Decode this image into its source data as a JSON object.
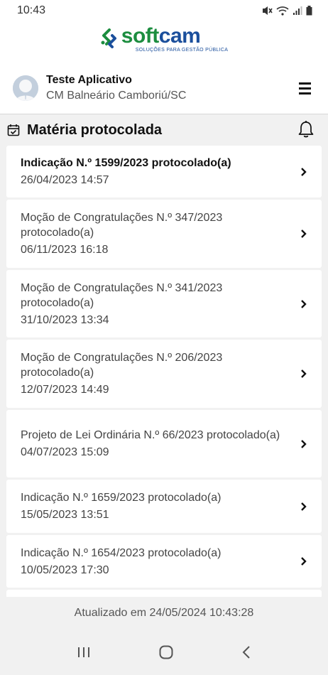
{
  "status_bar": {
    "time": "10:43"
  },
  "logo": {
    "word_part1": "soft",
    "word_part2": "cam",
    "tagline": "SOLUÇÕES PARA GESTÃO PÚBLICA"
  },
  "user": {
    "name": "Teste Aplicativo",
    "organization": "CM Balneário Camboriú/SC"
  },
  "section": {
    "title": "Matéria protocolada"
  },
  "items": [
    {
      "title": "Indicação N.º 1599/2023 protocolado(a)",
      "date": "26/04/2023 14:57",
      "unread": true
    },
    {
      "title": "Moção de Congratulações N.º 347/2023 protocolado(a)",
      "date": "06/11/2023 16:18",
      "unread": false
    },
    {
      "title": "Moção de Congratulações N.º 341/2023 protocolado(a)",
      "date": "31/10/2023 13:34",
      "unread": false
    },
    {
      "title": "Moção de Congratulações N.º 206/2023 protocolado(a)",
      "date": "12/07/2023 14:49",
      "unread": false
    },
    {
      "title": "Projeto de Lei Ordinária N.º 66/2023 protocolado(a)",
      "date": "04/07/2023 15:09",
      "unread": false
    },
    {
      "title": "Indicação N.º 1659/2023 protocolado(a)",
      "date": "15/05/2023 13:51",
      "unread": false
    },
    {
      "title": "Indicação N.º 1654/2023 protocolado(a)",
      "date": "10/05/2023 17:30",
      "unread": false
    }
  ],
  "footer": {
    "updated_text": "Atualizado em 24/05/2024 10:43:28"
  },
  "colors": {
    "brand_green": "#1c8d3f",
    "brand_blue": "#1b4f9c",
    "background": "#f1f1f1"
  }
}
